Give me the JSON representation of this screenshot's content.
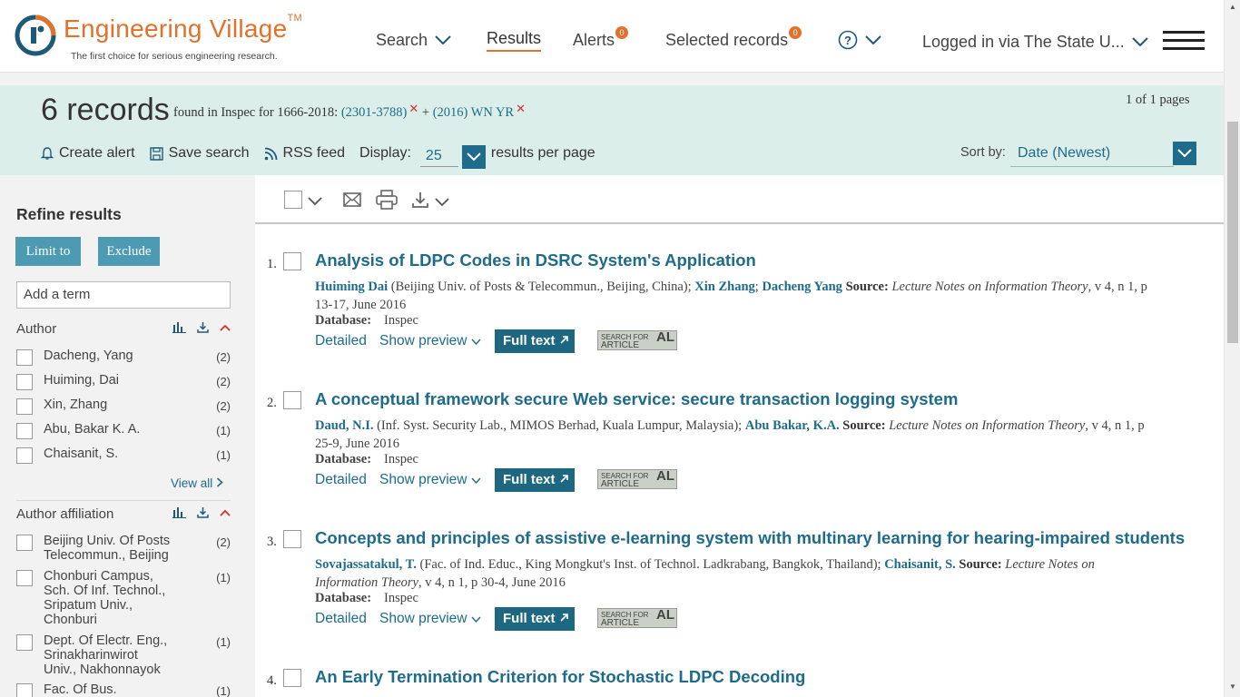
{
  "header": {
    "brand": "Engineering Village",
    "brand_tm": "TM",
    "tagline": "The first choice for serious engineering research.",
    "nav": {
      "search": "Search",
      "results": "Results",
      "alerts": "Alerts",
      "alerts_count": "0",
      "selected": "Selected records",
      "selected_count": "0",
      "login": "Logged in via The State U..."
    }
  },
  "summary": {
    "count": "6 records",
    "found_text": "found in Inspec for 1666-2018:",
    "term1": "(2301-3788)",
    "term_join": "+",
    "term2": "(2016) WN YR",
    "pages": "1 of 1 pages",
    "create_alert": "Create alert",
    "save_search": "Save search",
    "rss_feed": "RSS feed",
    "display_label": "Display:",
    "display_value": "25",
    "per_page": "results per page",
    "sort_label": "Sort by:",
    "sort_value": "Date (Newest)"
  },
  "sidebar": {
    "title": "Refine results",
    "limit_to": "Limit to",
    "exclude": "Exclude",
    "add_term_placeholder": "Add a term",
    "author_heading": "Author",
    "authors": [
      {
        "label": "Dacheng, Yang",
        "count": "(2)"
      },
      {
        "label": "Huiming, Dai",
        "count": "(2)"
      },
      {
        "label": "Xin, Zhang",
        "count": "(2)"
      },
      {
        "label": "Abu, Bakar K. A.",
        "count": "(1)"
      },
      {
        "label": "Chaisanit, S.",
        "count": "(1)"
      }
    ],
    "view_all": "View all",
    "affiliation_heading": "Author affiliation",
    "affiliations": [
      {
        "label": "Beijing Univ. Of Posts\nTelecommun., Beijing",
        "count": "(2)"
      },
      {
        "label": "Chonburi Campus,\nSch. Of Inf. Technol.,\nSripatum Univ.,\nChonburi",
        "count": "(1)"
      },
      {
        "label": "Dept. Of Electr. Eng.,\nSrinakharinwirot\nUniv., Nakhonnayok",
        "count": "(1)"
      },
      {
        "label": "Fac. Of Bus.",
        "count": "(1)"
      }
    ]
  },
  "results": {
    "database_label": "Database:",
    "detailed": "Detailed",
    "show_preview": "Show preview",
    "full_text": "Full text",
    "sfa_line1": "SEARCH FOR",
    "sfa_line2": "ARTICLE",
    "sfa_logo": "AL",
    "items": [
      {
        "num": "1.",
        "title": "Analysis of LDPC Codes in DSRC System's Application",
        "author1": "Huiming Dai",
        "aff1": " (Beijing Univ. of Posts & Telecommun., Beijing, China); ",
        "author2": "Xin Zhang",
        "sep2": "; ",
        "author3": "Dacheng Yang",
        "source_label": " Source: ",
        "source": "Lecture Notes on Information Theory",
        "citation": ", v 4, n 1, p 13-17, June 2016",
        "database": "Inspec"
      },
      {
        "num": "2.",
        "title": "A conceptual framework secure Web service: secure transaction logging system",
        "author1": "Daud, N.I.",
        "aff1": " (Inf. Syst. Security Lab., MIMOS Berhad, Kuala Lumpur, Malaysia); ",
        "author2": "Abu Bakar, K.A.",
        "source_label": " Source: ",
        "source": "Lecture Notes on Information Theory",
        "citation": ", v 4, n 1, p 25-9, June 2016",
        "database": "Inspec"
      },
      {
        "num": "3.",
        "title": "Concepts and principles of assistive e-learning system with multinary learning for hearing-impaired students",
        "author1": "Sovajassatakul, T.",
        "aff1": " (Fac. of Ind. Educ., King Mongkut's Inst. of Technol. Ladkrabang, Bangkok, Thailand); ",
        "author2": "Chaisanit, S.",
        "source_label": " Source: ",
        "source": "Lecture Notes on Information Theory",
        "citation": ", v 4, n 1, p 30-4, June 2016",
        "database": "Inspec"
      },
      {
        "num": "4.",
        "title": "An Early Termination Criterion for Stochastic LDPC Decoding"
      }
    ]
  },
  "colors": {
    "brand_orange": "#e2712b",
    "link_blue": "#1e6b8c",
    "summary_bg": "#dbeee9",
    "button_blue": "#4d9ab3"
  }
}
